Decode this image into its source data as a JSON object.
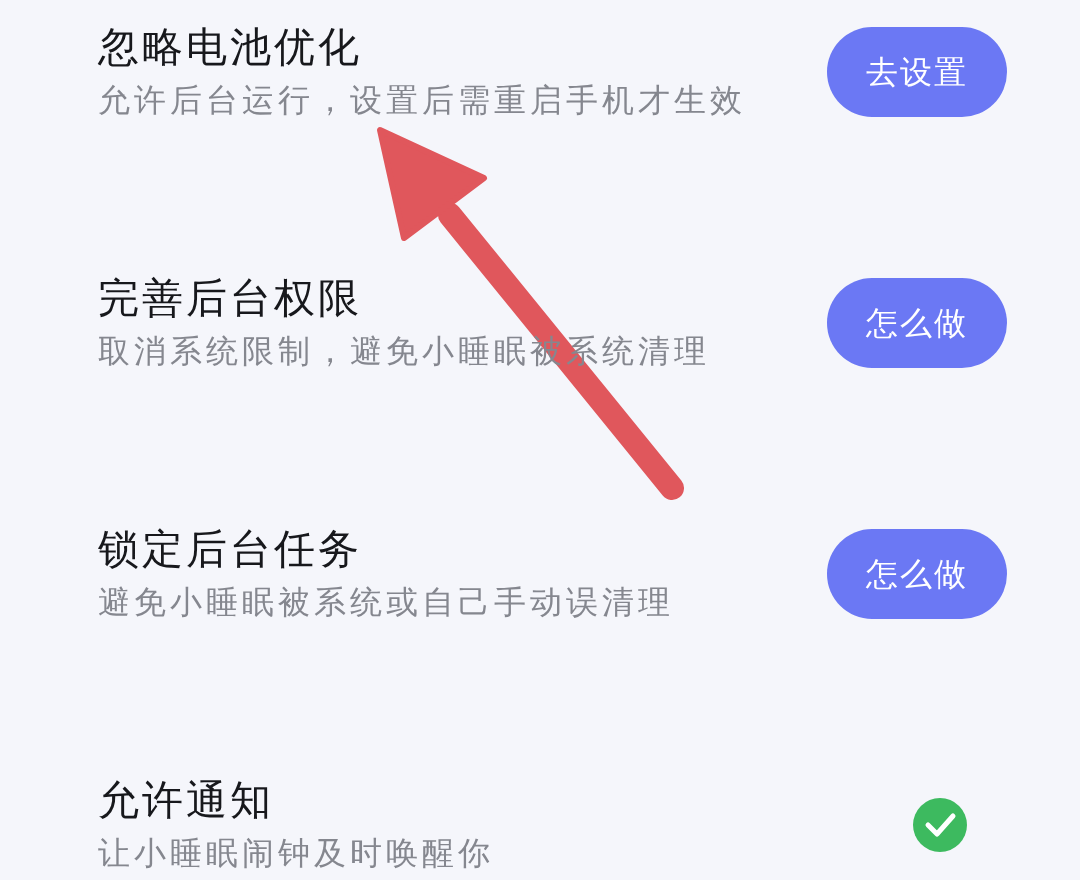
{
  "settings": [
    {
      "title": "忽略电池优化",
      "subtitle": "允许后台运行，设置后需重启手机才生效",
      "kind": "button",
      "button": "去设置"
    },
    {
      "title": "完善后台权限",
      "subtitle": "取消系统限制，避免小睡眠被系统清理",
      "kind": "button",
      "button": "怎么做"
    },
    {
      "title": "锁定后台任务",
      "subtitle": "避免小睡眠被系统或自己手动误清理",
      "kind": "button",
      "button": "怎么做"
    },
    {
      "title": "允许通知",
      "subtitle": "让小睡眠闹钟及时唤醒你",
      "kind": "status",
      "checked": true
    }
  ]
}
